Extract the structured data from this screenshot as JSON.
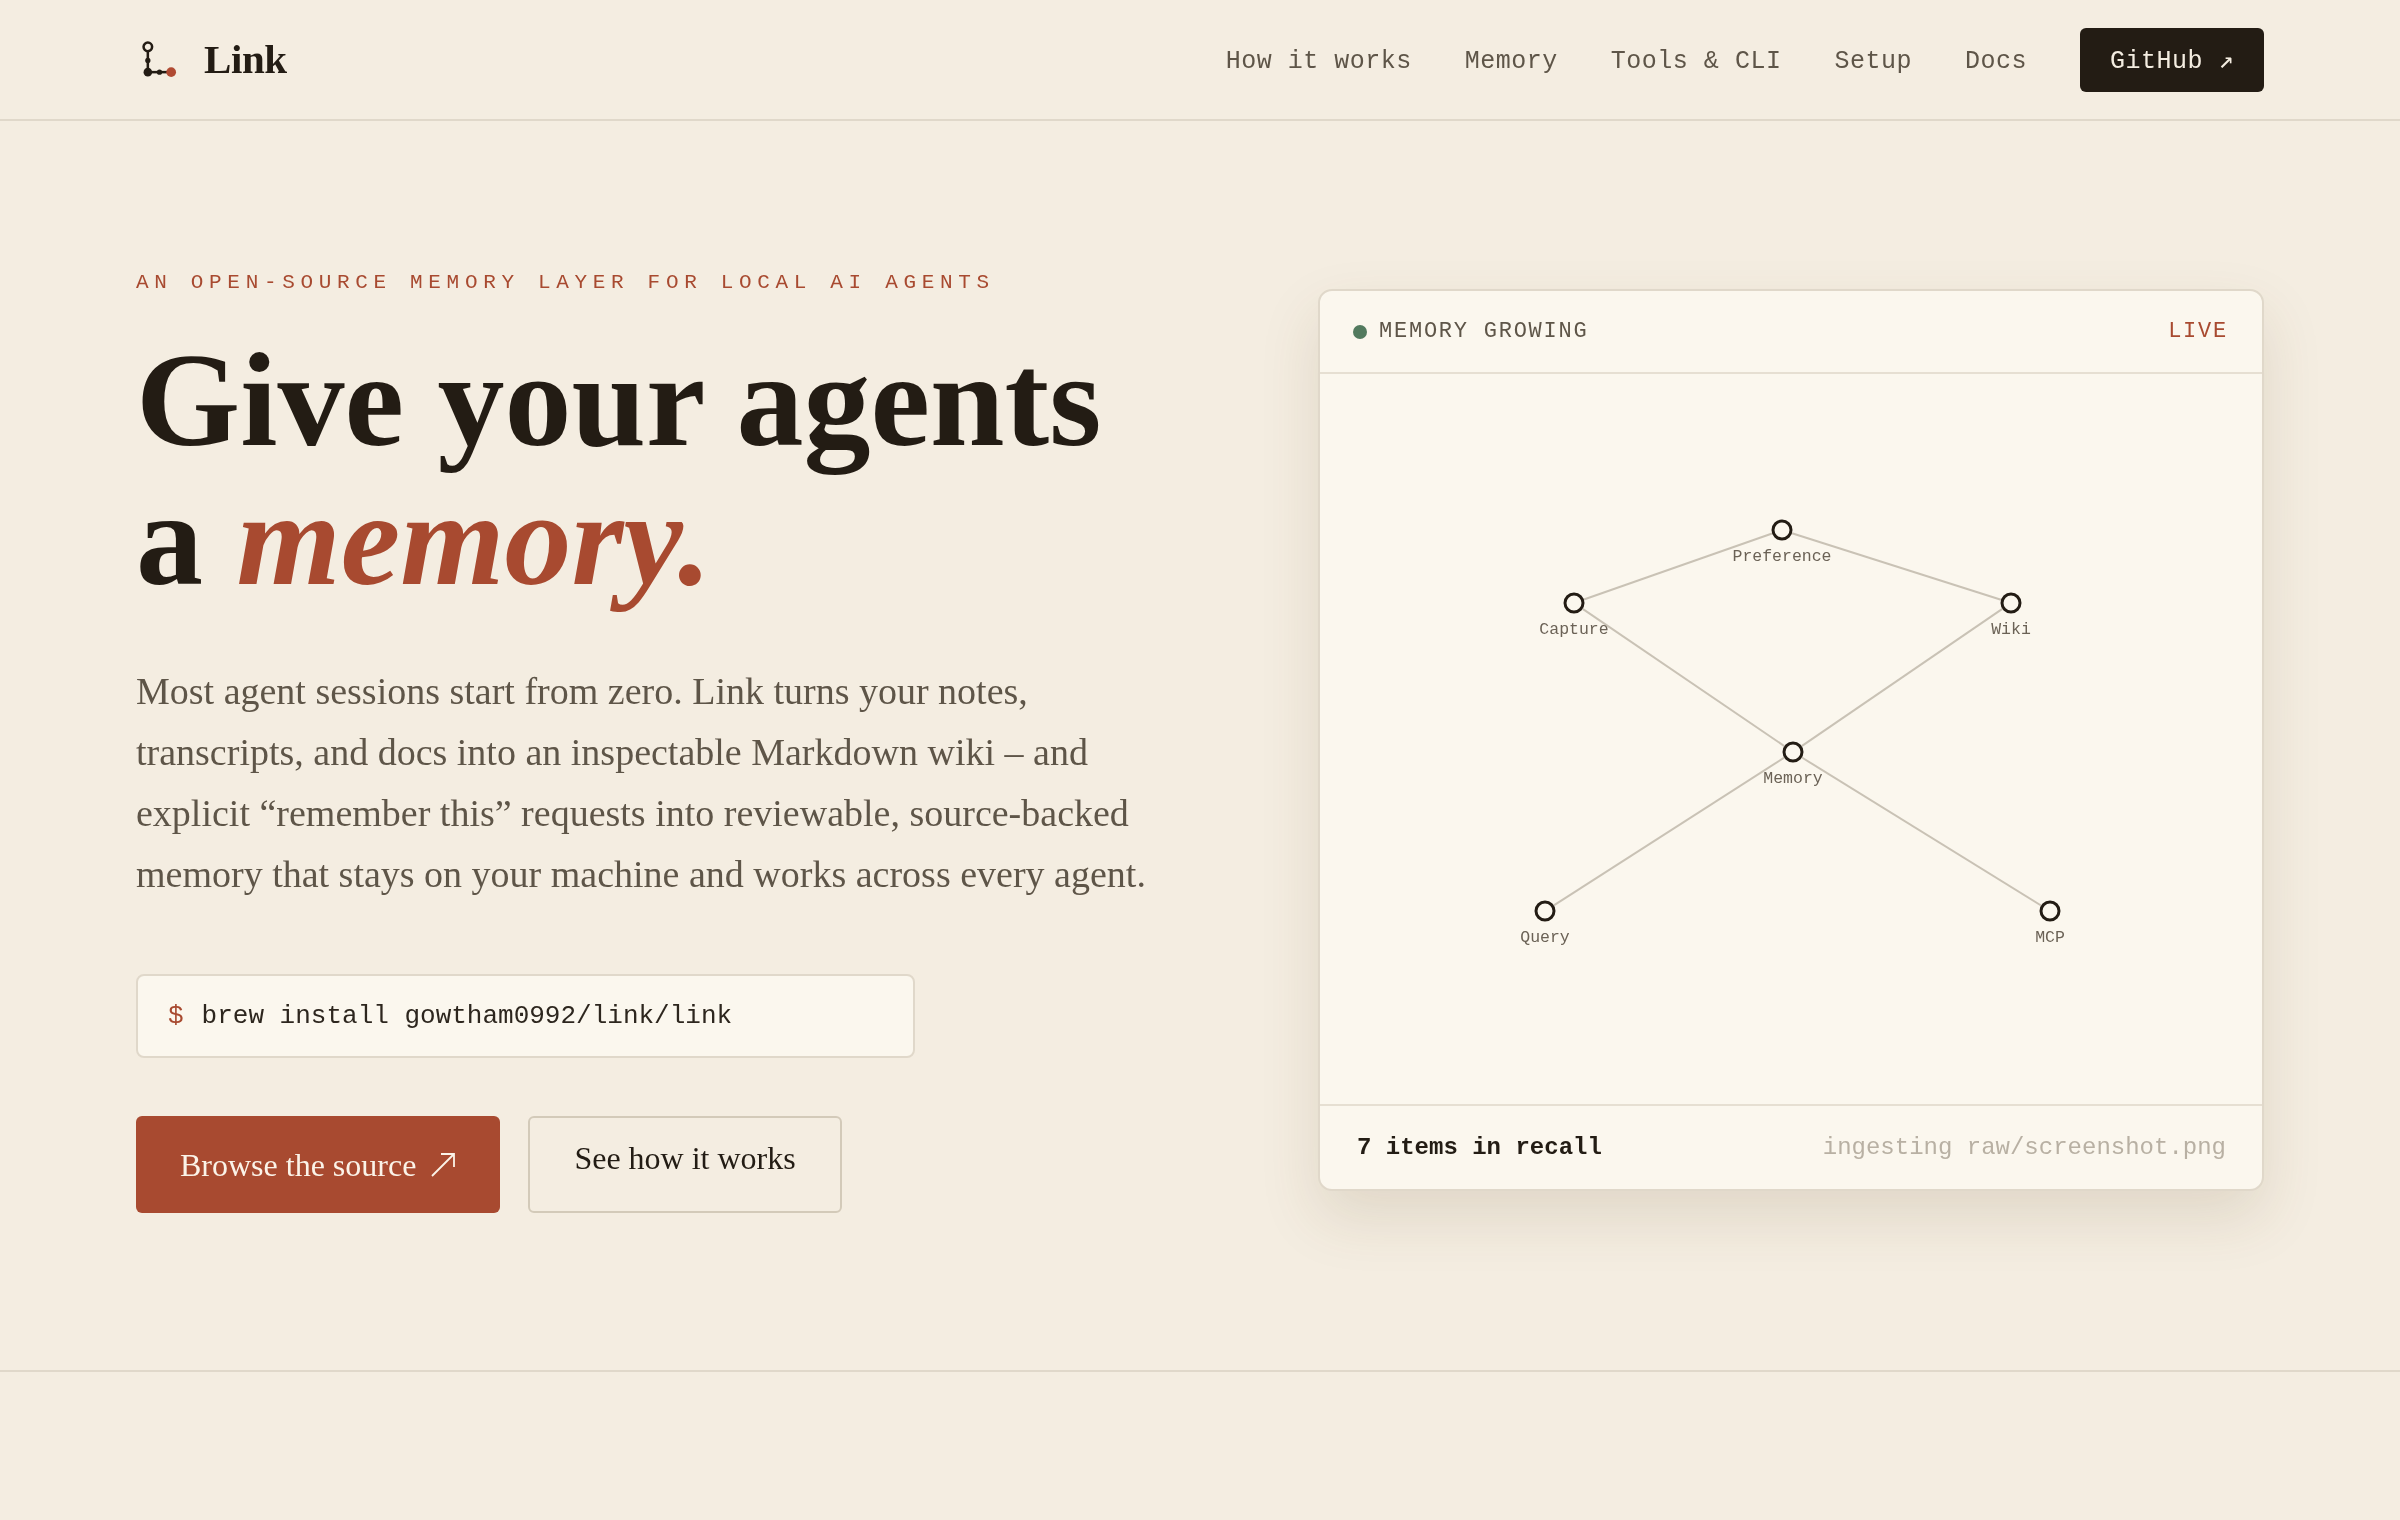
{
  "header": {
    "logo_text": "Link",
    "nav": [
      {
        "label": "How it works"
      },
      {
        "label": "Memory"
      },
      {
        "label": "Tools & CLI"
      },
      {
        "label": "Setup"
      },
      {
        "label": "Docs"
      }
    ],
    "github_button": "GitHub ↗"
  },
  "hero": {
    "eyebrow": "AN OPEN-SOURCE MEMORY LAYER FOR LOCAL AI AGENTS",
    "headline": [
      "Give your agents",
      "a *memory.*"
    ],
    "description": "Most agent sessions start from zero. Link turns your notes, transcripts, and docs into an inspectable Markdown wiki – and explicit “remember this” requests into reviewable, source-backed memory that stays on your machine and works across every agent.",
    "command": {
      "prompt": "$",
      "text": "brew install gowtham0992/link/link"
    },
    "buttons": [
      {
        "kind": "primary",
        "label": "Browse the source"
      },
      {
        "kind": "secondary",
        "label": "See how it works"
      }
    ]
  },
  "memory_card": {
    "title": "MEMORY GROWING",
    "badge": "LIVE",
    "graph": {
      "nodes": [
        {
          "label": "Preference"
        },
        {
          "label": "Capture"
        },
        {
          "label": "Wiki"
        },
        {
          "label": "Memory"
        },
        {
          "label": "Query"
        },
        {
          "label": "MCP"
        }
      ]
    },
    "footer": {
      "count": "7 items in recall",
      "activity": "ingesting raw/screenshot.png"
    }
  }
}
